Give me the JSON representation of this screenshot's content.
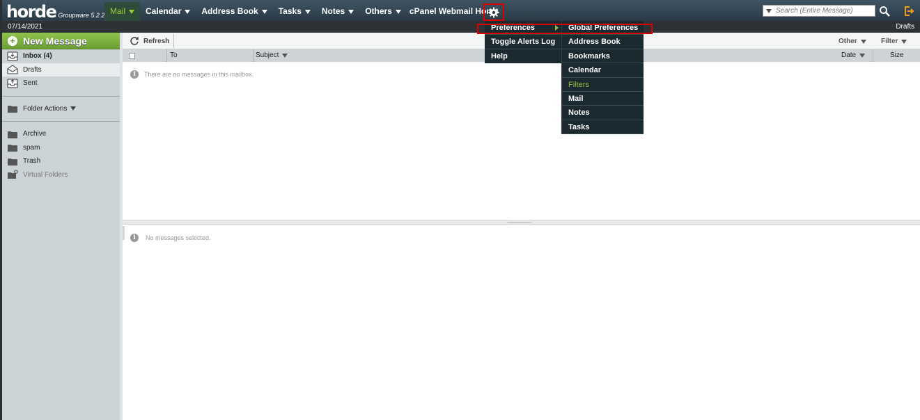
{
  "brand": {
    "name": "horde",
    "subtitle": "Groupware 5.2.22"
  },
  "nav": [
    {
      "label": "Mail",
      "active": true,
      "caret": true
    },
    {
      "label": "Calendar",
      "caret": true
    },
    {
      "label": "Address Book",
      "caret": true
    },
    {
      "label": "Tasks",
      "caret": true
    },
    {
      "label": "Notes",
      "caret": true
    },
    {
      "label": "Others",
      "caret": true
    },
    {
      "label": "cPanel Webmail Home",
      "caret": false
    }
  ],
  "search": {
    "placeholder": "Search (Entire Message)"
  },
  "datebar": {
    "date": "07/14/2021",
    "current_folder": "Drafts"
  },
  "sidebar": {
    "new_message": "New Message",
    "folders": [
      {
        "label": "Inbox (4)",
        "icon": "inbox-icon"
      },
      {
        "label": "Drafts",
        "icon": "drafts-icon"
      },
      {
        "label": "Sent",
        "icon": "sent-icon"
      }
    ],
    "folder_actions": "Folder Actions",
    "other_folders": [
      {
        "label": "Archive"
      },
      {
        "label": "spam"
      },
      {
        "label": "Trash"
      },
      {
        "label": "Virtual Folders"
      }
    ]
  },
  "toolbar": {
    "refresh": "Refresh",
    "other": "Other",
    "filter": "Filter"
  },
  "columns": {
    "to": "To",
    "subject": "Subject",
    "date": "Date",
    "size": "Size"
  },
  "messages": {
    "empty": "There are no messages in this mailbox.",
    "preview_empty": "No messages selected."
  },
  "gear_menu": [
    {
      "label": "Preferences",
      "submenu": true
    },
    {
      "label": "Toggle Alerts Log"
    },
    {
      "label": "Help"
    }
  ],
  "preferences_menu": [
    {
      "label": "Global Preferences"
    },
    {
      "label": "Address Book"
    },
    {
      "label": "Bookmarks"
    },
    {
      "label": "Calendar"
    },
    {
      "label": "Filters",
      "highlight": true
    },
    {
      "label": "Mail"
    },
    {
      "label": "Notes"
    },
    {
      "label": "Tasks"
    }
  ],
  "colors": {
    "accent_green": "#8fbf3a",
    "menu_bg": "#1b2a30",
    "highlight_red": "#dd0000"
  }
}
